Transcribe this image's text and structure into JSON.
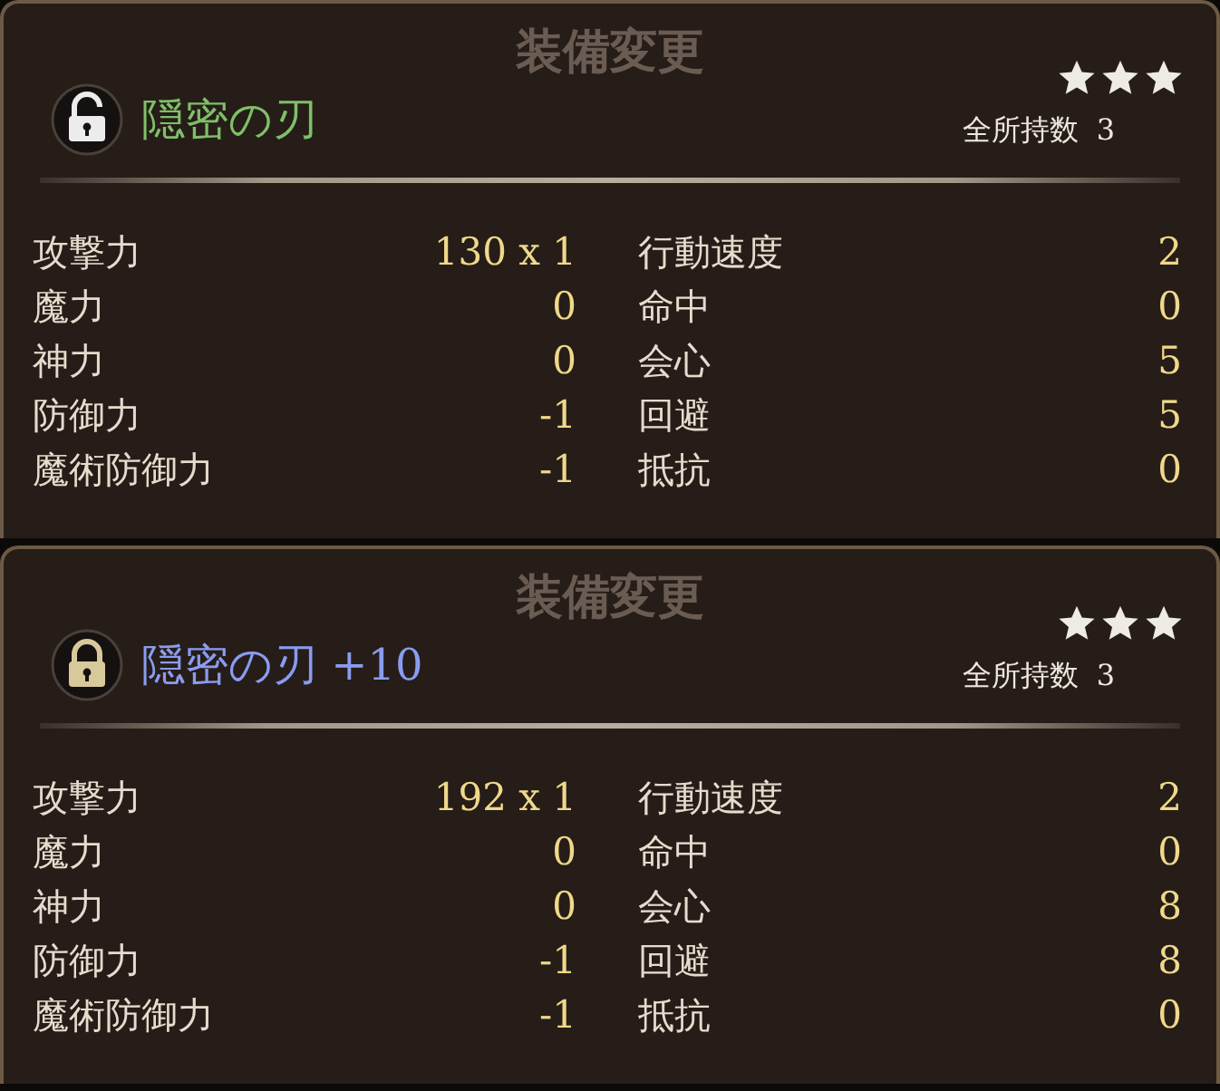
{
  "panels": [
    {
      "screen_title": "装備変更",
      "locked": false,
      "name": "隠密の刃",
      "color": "#7fbf6a",
      "stars": 3,
      "owned_label": "全所持数",
      "owned_count": "3",
      "stats_left": [
        {
          "label": "攻撃力",
          "value": "130 x 1"
        },
        {
          "label": "魔力",
          "value": "0"
        },
        {
          "label": "神力",
          "value": "0"
        },
        {
          "label": "防御力",
          "value": "-1"
        },
        {
          "label": "魔術防御力",
          "value": "-1"
        }
      ],
      "stats_right": [
        {
          "label": "行動速度",
          "value": "2"
        },
        {
          "label": "命中",
          "value": "0"
        },
        {
          "label": "会心",
          "value": "5"
        },
        {
          "label": "回避",
          "value": "5"
        },
        {
          "label": "抵抗",
          "value": "0"
        }
      ]
    },
    {
      "screen_title": "装備変更",
      "locked": true,
      "name": "隠密の刃 +10",
      "color": "#8a9cf0",
      "stars": 3,
      "owned_label": "全所持数",
      "owned_count": "3",
      "stats_left": [
        {
          "label": "攻撃力",
          "value": "192 x 1"
        },
        {
          "label": "魔力",
          "value": "0"
        },
        {
          "label": "神力",
          "value": "0"
        },
        {
          "label": "防御力",
          "value": "-1"
        },
        {
          "label": "魔術防御力",
          "value": "-1"
        }
      ],
      "stats_right": [
        {
          "label": "行動速度",
          "value": "2"
        },
        {
          "label": "命中",
          "value": "0"
        },
        {
          "label": "会心",
          "value": "8"
        },
        {
          "label": "回避",
          "value": "8"
        },
        {
          "label": "抵抗",
          "value": "0"
        }
      ]
    }
  ]
}
